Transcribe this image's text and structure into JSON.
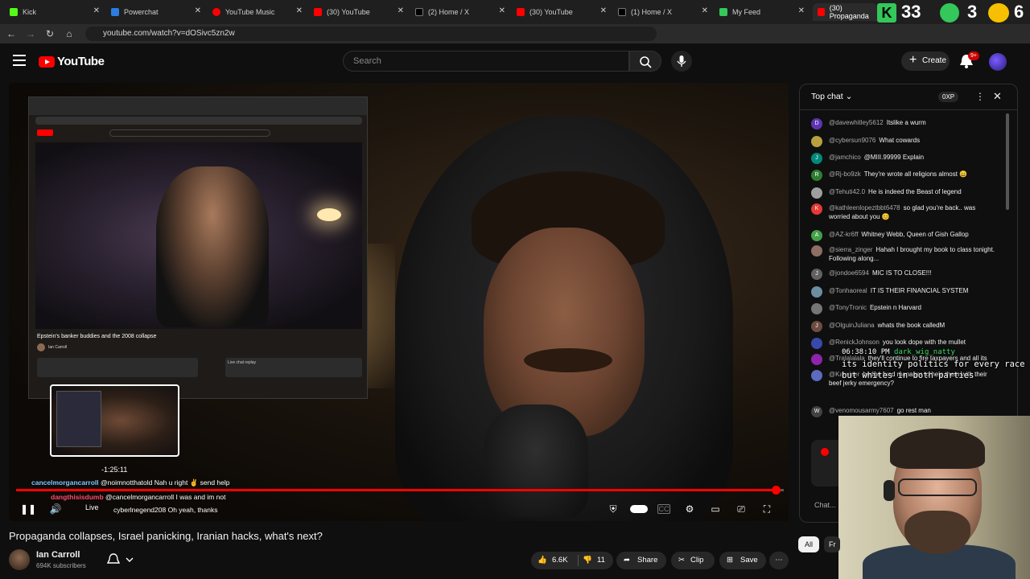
{
  "browser": {
    "tabs": [
      {
        "label": "Kick",
        "color": "#53fc18"
      },
      {
        "label": "Powerchat",
        "color": "#2a7de1"
      },
      {
        "label": "YouTube Music",
        "color": "#ff0000"
      },
      {
        "label": "(30) YouTube",
        "color": "#ff0000"
      },
      {
        "label": "(2) Home / X",
        "color": "#000000"
      },
      {
        "label": "(30) YouTube",
        "color": "#ff0000"
      },
      {
        "label": "(1) Home / X",
        "color": "#000000"
      },
      {
        "label": "My Feed",
        "color": "#34c759"
      },
      {
        "label": "(30) Propaganda",
        "color": "#ff0000"
      }
    ],
    "url": "youtube.com/watch?v=dOSivc5zn2w",
    "overlay": {
      "k": "K",
      "n1": "33",
      "n2": "3",
      "n3": "6"
    }
  },
  "youtube": {
    "logo_text": "YouTube",
    "search_placeholder": "Search",
    "create_label": "Create",
    "notif_badge": "9+"
  },
  "player": {
    "inner_title": "Epstein's banker buddies and the 2008 collapse",
    "inner_channel": "Ian Carroll",
    "inner_chat_replay": "Live chat replay",
    "thumb_time": "-1:25:11",
    "live_label": "Live",
    "progress_fraction": 0.99,
    "chat_overlay": [
      {
        "user": "cancelmorgancarroll",
        "msg": "@noimnotthatold Nah u right ✌ send help",
        "user_color": "#7fc8ff"
      },
      {
        "user": "dangthisisdumb",
        "msg": "@cancelmorgancarroll I was and im not",
        "user_color": "#ff4b6e"
      },
      {
        "user": "",
        "msg": "cyberlnegend208 Oh yeah, thanks",
        "user_color": "#ffffff"
      }
    ]
  },
  "video": {
    "title": "Propaganda collapses, Israel panicking, Iranian hacks, what's next?",
    "channel": "Ian Carroll",
    "subscribers": "694K subscribers",
    "likes": "6.6K",
    "dislikes": "11",
    "share": "Share",
    "clip": "Clip",
    "save": "Save"
  },
  "chat": {
    "header": "Top chat",
    "xp": "0XP",
    "messages": [
      {
        "initial": "D",
        "color": "#5e35b1",
        "user": "@davewhitley5612",
        "msg": "Itslike a wurm"
      },
      {
        "initial": "",
        "color": "#b8a040",
        "user": "@cybersun9076",
        "msg": "What cowards"
      },
      {
        "initial": "J",
        "color": "#00897b",
        "user": "@jamchico",
        "msg": "@MIII.99999 Explain"
      },
      {
        "initial": "R",
        "color": "#2e7d32",
        "user": "@Rj-bo9zk",
        "msg": "They're wrote all religions almost 😄"
      },
      {
        "initial": "",
        "color": "#9e9e9e",
        "user": "@Tehuti42.0",
        "msg": "He is indeed the Beast of legend"
      },
      {
        "initial": "K",
        "color": "#e53935",
        "user": "@kathleenlopeztbbt6478",
        "msg": "so glad you're back.. was worried about you 😊"
      },
      {
        "initial": "A",
        "color": "#43a047",
        "user": "@AZ-kr6ff",
        "msg": "Whitney Webb, Queen of Gish Gallop"
      },
      {
        "initial": "",
        "color": "#8d6e63",
        "user": "@sierra_zinger",
        "msg": "Hahah I brought my book to class tonight. Following along..."
      },
      {
        "initial": "J",
        "color": "#616161",
        "user": "@jondoe6594",
        "msg": "MIC IS TO CLOSE!!!"
      },
      {
        "initial": "",
        "color": "#6d8ea0",
        "user": "@Tonhaoreal",
        "msg": "IT IS THEIR FINANCIAL SYSTEM"
      },
      {
        "initial": "",
        "color": "#757575",
        "user": "@TonyTronic",
        "msg": "Epstein n Harvard"
      },
      {
        "initial": "J",
        "color": "#6d4c41",
        "user": "@OlguinJuliana",
        "msg": "whats the book calledM"
      },
      {
        "initial": "",
        "color": "#3949ab",
        "user": "@RenickJohnson",
        "msg": "you look dope with the mullet"
      },
      {
        "initial": "",
        "color": "#8e24aa",
        "user": "@Tralalalala",
        "msg": "they'll continue to fire taxpayers and all its"
      },
      {
        "initial": "",
        "color": "#5c6bc0",
        "user": "@Kaiwiser",
        "msg": "hedge fund manager to help them with their beef jerky emergency?"
      },
      {
        "initial": "W",
        "color": "#424242",
        "user": "@venomousarmy7607",
        "msg": "go rest man"
      }
    ],
    "input_placeholder": "Chat..."
  },
  "stream_overlay": {
    "timestamp": "06:38:10 PM",
    "user": "dark_wig_natty",
    "line1": "its identity politics for every race",
    "line2": "but whites in both parties"
  },
  "filters": {
    "all": "All",
    "friends": "Fr"
  }
}
